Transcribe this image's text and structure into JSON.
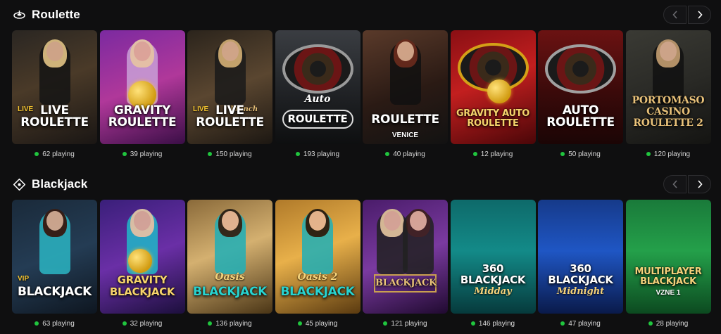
{
  "roulette": {
    "title": "Roulette",
    "icon": "roulette-icon",
    "games": [
      {
        "id": "live-roulette",
        "title": "LIVE ROULETTE",
        "subtitle": "",
        "players": "62 playing"
      },
      {
        "id": "gravity-roulette",
        "title": "GRAVITY ROULETTE",
        "subtitle": "",
        "players": "39 playing"
      },
      {
        "id": "live-french-roulette",
        "title": "LIVE ROULETTE",
        "subtitle": "French",
        "players": "150 playing"
      },
      {
        "id": "auto-roulette-1",
        "title": "ROULETTE",
        "subtitle": "Auto",
        "players": "193 playing"
      },
      {
        "id": "roulette-venice",
        "title": "ROULETTE",
        "subtitle": "VENICE",
        "players": "40 playing"
      },
      {
        "id": "gravity-auto-roulette",
        "title": "GRAVITY AUTO ROULETTE",
        "subtitle": "",
        "players": "12 playing"
      },
      {
        "id": "auto-roulette",
        "title": "AUTO ROULETTE",
        "subtitle": "",
        "players": "50 playing"
      },
      {
        "id": "portomaso-casino-roulette-2",
        "title": "PORTOMASO CASINO ROULETTE 2",
        "subtitle": "",
        "players": "120 playing"
      }
    ]
  },
  "blackjack": {
    "title": "Blackjack",
    "icon": "blackjack-diamond-icon",
    "games": [
      {
        "id": "vip-blackjack",
        "title": "BLACKJACK",
        "subtitle": "VIP",
        "players": "63 playing"
      },
      {
        "id": "gravity-blackjack",
        "title": "GRAVITY BLACKJACK",
        "subtitle": "",
        "players": "32 playing"
      },
      {
        "id": "oasis-blackjack",
        "title": "BLACKJACK",
        "subtitle": "Oasis",
        "players": "136 playing"
      },
      {
        "id": "oasis-2-blackjack",
        "title": "BLACKJACK",
        "subtitle": "Oasis 2",
        "players": "45 playing"
      },
      {
        "id": "blackjack-classic",
        "title": "BLACKJACK",
        "subtitle": "",
        "players": "121 playing"
      },
      {
        "id": "360-blackjack-midday",
        "title": "360 BLACKJACK",
        "subtitle": "Midday",
        "players": "146 playing"
      },
      {
        "id": "360-blackjack-midnight",
        "title": "360 BLACKJACK",
        "subtitle": "Midnight",
        "players": "47 playing"
      },
      {
        "id": "multiplayer-blackjack",
        "title": "MULTIPLAYER BLACKJACK",
        "subtitle": "VZNE 1",
        "players": "28 playing"
      }
    ]
  },
  "nav": {
    "prev_icon": "chevron-left-icon",
    "next_icon": "chevron-right-icon"
  },
  "colors": {
    "background": "#0f0f10",
    "status_dot": "#20c53e",
    "text": "#ffffff",
    "muted": "#d8d8d8"
  }
}
